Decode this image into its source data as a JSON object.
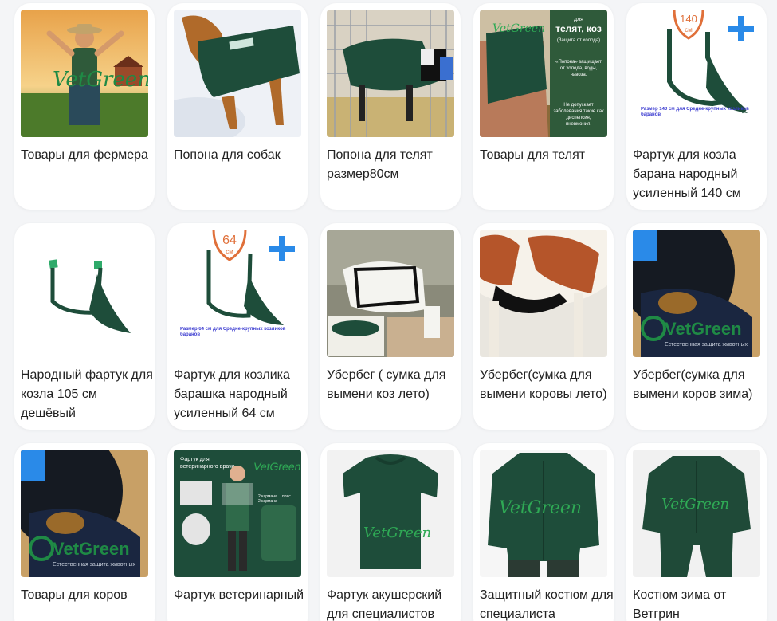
{
  "products": [
    {
      "title": "Товары для фермера",
      "image": "farmer-vetgreen-poster",
      "logo": "VetGreen"
    },
    {
      "title": "Попона для собак",
      "image": "dog-blanket-photo"
    },
    {
      "title": "Попона для телят размер80см",
      "image": "calf-blanket-photo"
    },
    {
      "title": "Товары для телят",
      "image": "calf-blanket-infographic",
      "logo": "VetGreen",
      "overlay": {
        "line1": "для",
        "line2": "телят, коз",
        "line3": "(Защита от холода)",
        "line4": "«Попона» защищает от холода, воды, навоза.",
        "line5": "Не допускает заболевания такие как диспепсия, пневмония."
      }
    },
    {
      "title": "Фартук для козла барана народный усиленный 140 см",
      "image": "goat-apron-140",
      "badge": "140",
      "unit": "см",
      "caption": "Размер 140 см для Средне-крупных козликов баранов"
    },
    {
      "title": "Народный фартук для козла 105 см дешёвый",
      "image": "goat-apron-105"
    },
    {
      "title": "Фартук для козлика барашка народный усиленный 64 см",
      "image": "goat-apron-64",
      "badge": "64",
      "unit": "см",
      "caption": "Размер 64 см для Средне-крупных козликов баранов"
    },
    {
      "title": "Убербег ( сумка для вымени коз лето)",
      "image": "goat-udder-bag-photo"
    },
    {
      "title": "Убербег(сумка для вымени коровы лето)",
      "image": "cow-udder-bag-photo"
    },
    {
      "title": "Убербег(сумка для вымени коров зима)",
      "image": "cow-udder-bag-winter",
      "logo": "VetGreen",
      "logo_sub": "Естественная защита животных"
    },
    {
      "title": "Товары для коров",
      "image": "cow-udder-bag-winter",
      "logo": "VetGreen",
      "logo_sub": "Естественная защита животных"
    },
    {
      "title": "Фартук ветеринарный",
      "image": "vet-apron-infographic",
      "logo": "VetGreen",
      "overlay": {
        "line1": "Фартук для",
        "line2": "ветеринарного врача",
        "line3": "2 кармана",
        "line4": "2 кармана",
        "line5": "пояс"
      }
    },
    {
      "title": "Фартук акушерский для специалистов",
      "image": "obstetric-apron-photo",
      "logo": "VetGreen"
    },
    {
      "title": "Защитный костюм для специалиста",
      "image": "protective-suit-photo",
      "logo": "VetGreen"
    },
    {
      "title": "Костюм зима от Ветгрин",
      "image": "winter-suit-photo",
      "logo": "VetGreen"
    }
  ],
  "colors": {
    "brand_green": "#1f6b45",
    "fabric_green": "#1e4d3a",
    "accent_blue": "#2a8ae8",
    "badge_orange": "#e0703a",
    "card_bg": "#ffffff",
    "page_bg": "#f4f5f7"
  }
}
